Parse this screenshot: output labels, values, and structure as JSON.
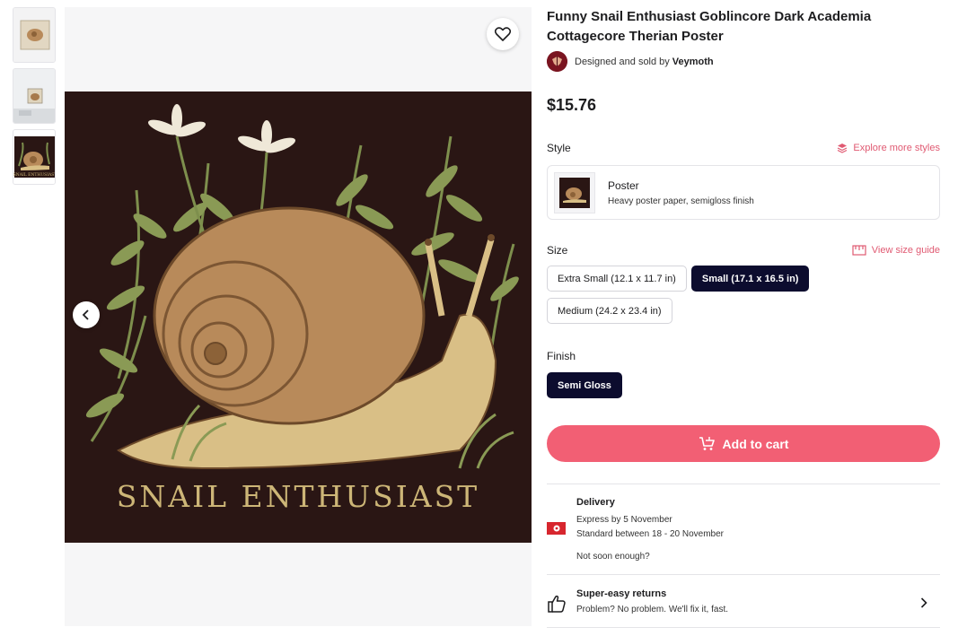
{
  "product": {
    "title": "Funny Snail Enthusiast Goblincore Dark Academia Cottagecore Therian Poster",
    "designed_by_prefix": "Designed and sold by",
    "artist": "Veymoth",
    "price": "$15.76",
    "poster_caption": "SNAIL ENTHUSIAST"
  },
  "thumbnails": [
    {
      "label": "thumbnail-framed-print"
    },
    {
      "label": "thumbnail-room-view"
    },
    {
      "label": "thumbnail-poster",
      "caption": "SNAIL ENTHUSIAST"
    }
  ],
  "style": {
    "label": "Style",
    "explore_link": "Explore more styles",
    "option_name": "Poster",
    "option_desc": "Heavy poster paper, semigloss finish"
  },
  "size": {
    "label": "Size",
    "guide_link": "View size guide",
    "options": [
      {
        "label": "Extra Small (12.1 x 11.7 in)",
        "selected": false
      },
      {
        "label": "Small (17.1 x 16.5 in)",
        "selected": true
      },
      {
        "label": "Medium (24.2 x 23.4 in)",
        "selected": false
      }
    ]
  },
  "finish": {
    "label": "Finish",
    "options": [
      {
        "label": "Semi Gloss",
        "selected": true
      }
    ]
  },
  "cart": {
    "label": "Add to cart"
  },
  "delivery": {
    "title": "Delivery",
    "express": "Express by 5 November",
    "standard": "Standard between 18 - 20 November",
    "not_soon": "Not soon enough?"
  },
  "returns": {
    "title": "Super-easy returns",
    "desc": "Problem? No problem. We'll fix it, fast."
  },
  "colors": {
    "accent": "#f25f74",
    "selected": "#0c0c2e",
    "poster_bg": "#2a1614",
    "link": "#e05a72"
  }
}
